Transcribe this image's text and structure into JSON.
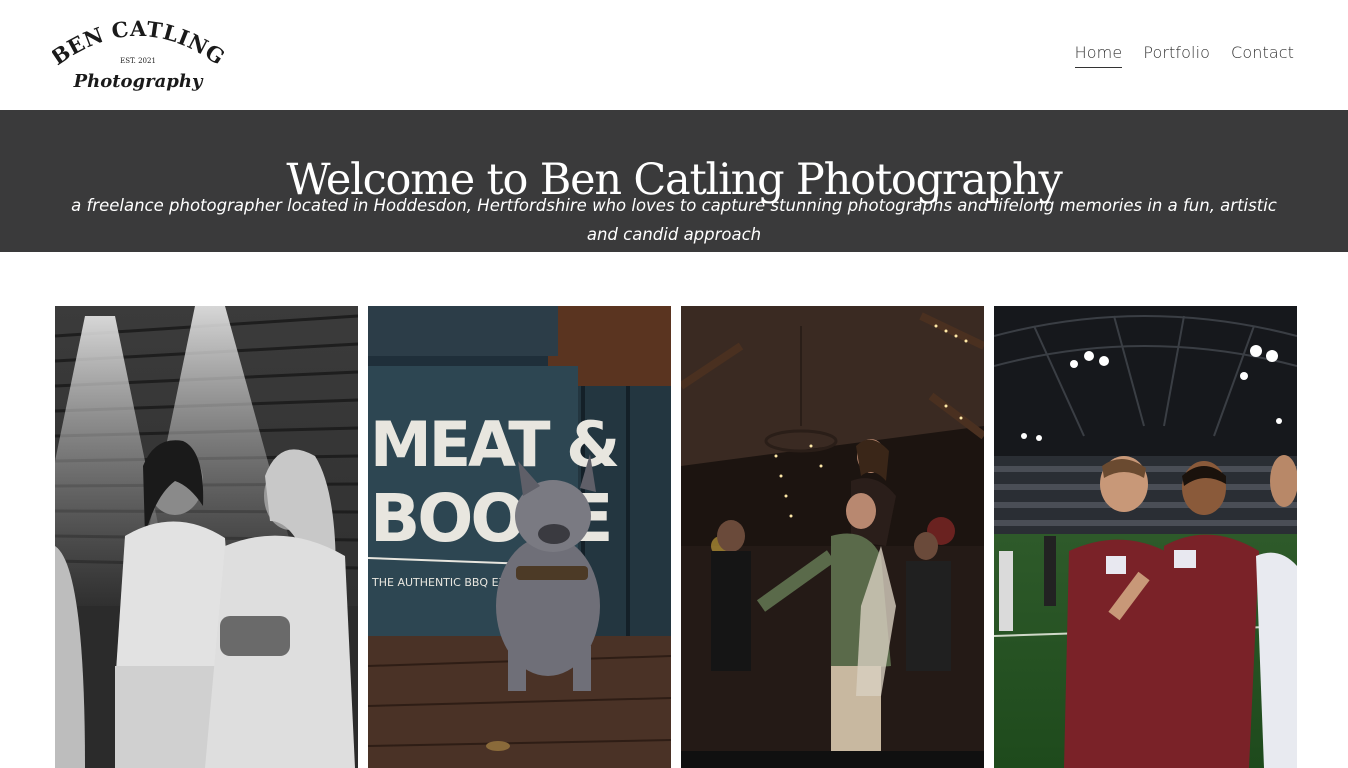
{
  "header": {
    "logo": {
      "line1": "BEN CATLING",
      "line2": "EST. 2021",
      "line3": "Photography"
    },
    "nav": [
      {
        "label": "Home",
        "active": true
      },
      {
        "label": "Portfolio",
        "active": false
      },
      {
        "label": "Contact",
        "active": false
      }
    ]
  },
  "hero": {
    "title": "Welcome to Ben Catling Photography",
    "subtitle": "a freelance photographer located in Hoddesdon, Hertfordshire who loves to capture stunning photographs and lifelong memories in a fun, artistic and candid approach"
  },
  "gallery": {
    "photos": [
      {
        "description": "black-and-white-two-women-laughing"
      },
      {
        "description": "french-bulldog-on-table-outside-restaurant"
      },
      {
        "description": "couple-dancing-at-party"
      },
      {
        "description": "footballers-celebrating-in-stadium"
      }
    ],
    "photo2_sign": {
      "line1": "MEAT &",
      "line2": "BOOZE",
      "line3": "THE AUTHENTIC BBQ EXPERIENCE"
    }
  },
  "colors": {
    "hero_background": "#3a3a3b",
    "text_dark": "#333333"
  }
}
